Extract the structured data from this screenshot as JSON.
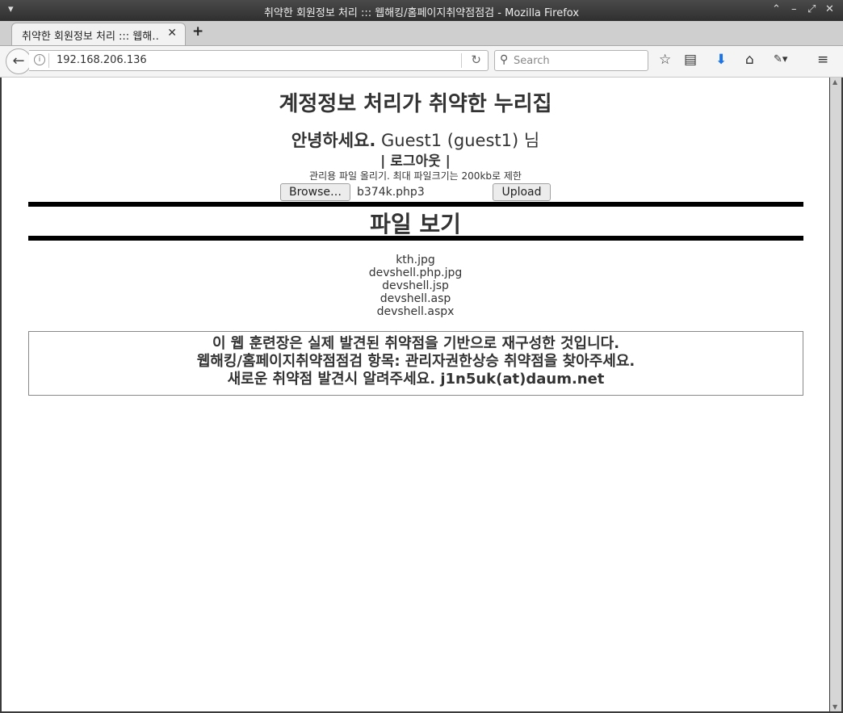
{
  "window": {
    "title": "취약한 회원정보 처리 ::: 웹해킹/홈페이지취약점점검 - Mozilla Firefox"
  },
  "tabs": [
    {
      "label": "취약한 회원정보 처리 ::: 웹해…"
    }
  ],
  "navbar": {
    "url": "192.168.206.136",
    "search_placeholder": "Search"
  },
  "page": {
    "heading": "계정정보 처리가 취약한 누리집",
    "greeting_prefix": "안녕하세요.",
    "greeting_user": "Guest1 (guest1)",
    "greeting_suffix": "님",
    "logout": "| 로그아웃 |",
    "upload_note": "관리용 파일 올리기. 최대 파일크기는 200kb로 제한",
    "browse_label": "Browse…",
    "selected_file": "b374k.php3",
    "upload_label": "Upload",
    "files_heading": "파일 보기",
    "files": [
      "kth.jpg",
      "devshell.php.jpg",
      "devshell.jsp",
      "devshell.asp",
      "devshell.aspx"
    ],
    "notice": [
      "이 웹 훈련장은 실제 발견된 취약점을 기반으로 재구성한 것입니다.",
      "웹해킹/홈페이지취약점점검 항목: 관리자권한상승 취약점을 찾아주세요.",
      "새로운 취약점 발견시 알려주세요. j1n5uk(at)daum.net"
    ]
  }
}
